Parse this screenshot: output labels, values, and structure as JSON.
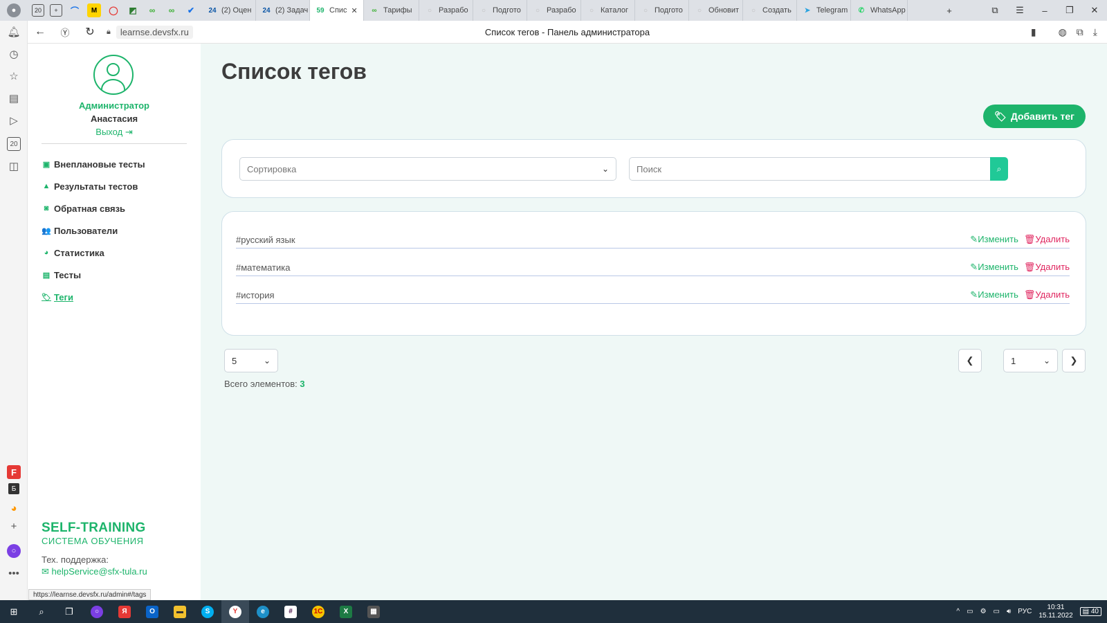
{
  "browser": {
    "tabs": [
      {
        "label": "(2) Оцен",
        "fav": "24",
        "favcolor": "#0a55a5"
      },
      {
        "label": "(2) Задач",
        "fav": "24",
        "favcolor": "#0a55a5"
      },
      {
        "label": "Спис",
        "fav": "59",
        "favcolor": "#1db46b",
        "active": true
      },
      {
        "label": "Тарифы",
        "fav": "∞",
        "favcolor": "#3cb034"
      },
      {
        "label": "Разрабо",
        "fav": "○",
        "favcolor": "#bbb"
      },
      {
        "label": "Подгото",
        "fav": "○",
        "favcolor": "#bbb"
      },
      {
        "label": "Разрабо",
        "fav": "○",
        "favcolor": "#bbb"
      },
      {
        "label": "Каталог",
        "fav": "○",
        "favcolor": "#bbb"
      },
      {
        "label": "Подгото",
        "fav": "○",
        "favcolor": "#bbb"
      },
      {
        "label": "Обновит",
        "fav": "○",
        "favcolor": "#bbb"
      },
      {
        "label": "Создать",
        "fav": "○",
        "favcolor": "#bbb"
      },
      {
        "label": "Telegram",
        "fav": "➤",
        "favcolor": "#2aa3df"
      },
      {
        "label": "WhatsApp",
        "fav": "✆",
        "favcolor": "#25d366"
      }
    ],
    "pinned_tab_counter": "20",
    "url": "learnse.devsfx.ru",
    "page_title": "Список тегов - Панель администратора",
    "status_url": "https://learnse.devsfx.ru/admin#/tags"
  },
  "profile": {
    "role": "Администратор",
    "name": "Анастасия",
    "logout": "Выход"
  },
  "menu": [
    {
      "label": "Внеплановые тесты",
      "icon": "calendar-icon",
      "glyph": "▣",
      "active": false
    },
    {
      "label": "Результаты тестов",
      "icon": "graduation-cap-icon",
      "glyph": "▲",
      "active": false
    },
    {
      "label": "Обратная связь",
      "icon": "comments-icon",
      "glyph": "◙",
      "active": false
    },
    {
      "label": "Пользователи",
      "icon": "users-icon",
      "glyph": "👥",
      "active": false
    },
    {
      "label": "Статистика",
      "icon": "pie-chart-icon",
      "glyph": "◕",
      "active": false
    },
    {
      "label": "Тесты",
      "icon": "tests-icon",
      "glyph": "▤",
      "active": false
    },
    {
      "label": "Теги",
      "icon": "tags-icon",
      "glyph": "🏷",
      "active": true
    }
  ],
  "brand": {
    "title": "SELF-TRAINING",
    "subtitle": "СИСТЕМА ОБУЧЕНИЯ",
    "support_label": "Тех. поддержка:",
    "support_email": "helpService@sfx-tula.ru"
  },
  "main": {
    "title": "Список тегов",
    "add_button": "Добавить тег",
    "sort_placeholder": "Сортировка",
    "search_placeholder": "Поиск",
    "tags": [
      {
        "name": "#русский язык"
      },
      {
        "name": "#математика"
      },
      {
        "name": "#история"
      }
    ],
    "edit_label": "Изменить",
    "delete_label": "Удалить",
    "page_size": "5",
    "total_label": "Всего элементов:",
    "total_value": "3",
    "page": "1"
  },
  "taskbar": {
    "lang": "РУС",
    "time": "10:31",
    "date": "15.11.2022",
    "notifications": "40"
  },
  "colors": {
    "accent": "#1db46b",
    "danger": "#e0245e",
    "main_bg": "#eff8f6"
  }
}
